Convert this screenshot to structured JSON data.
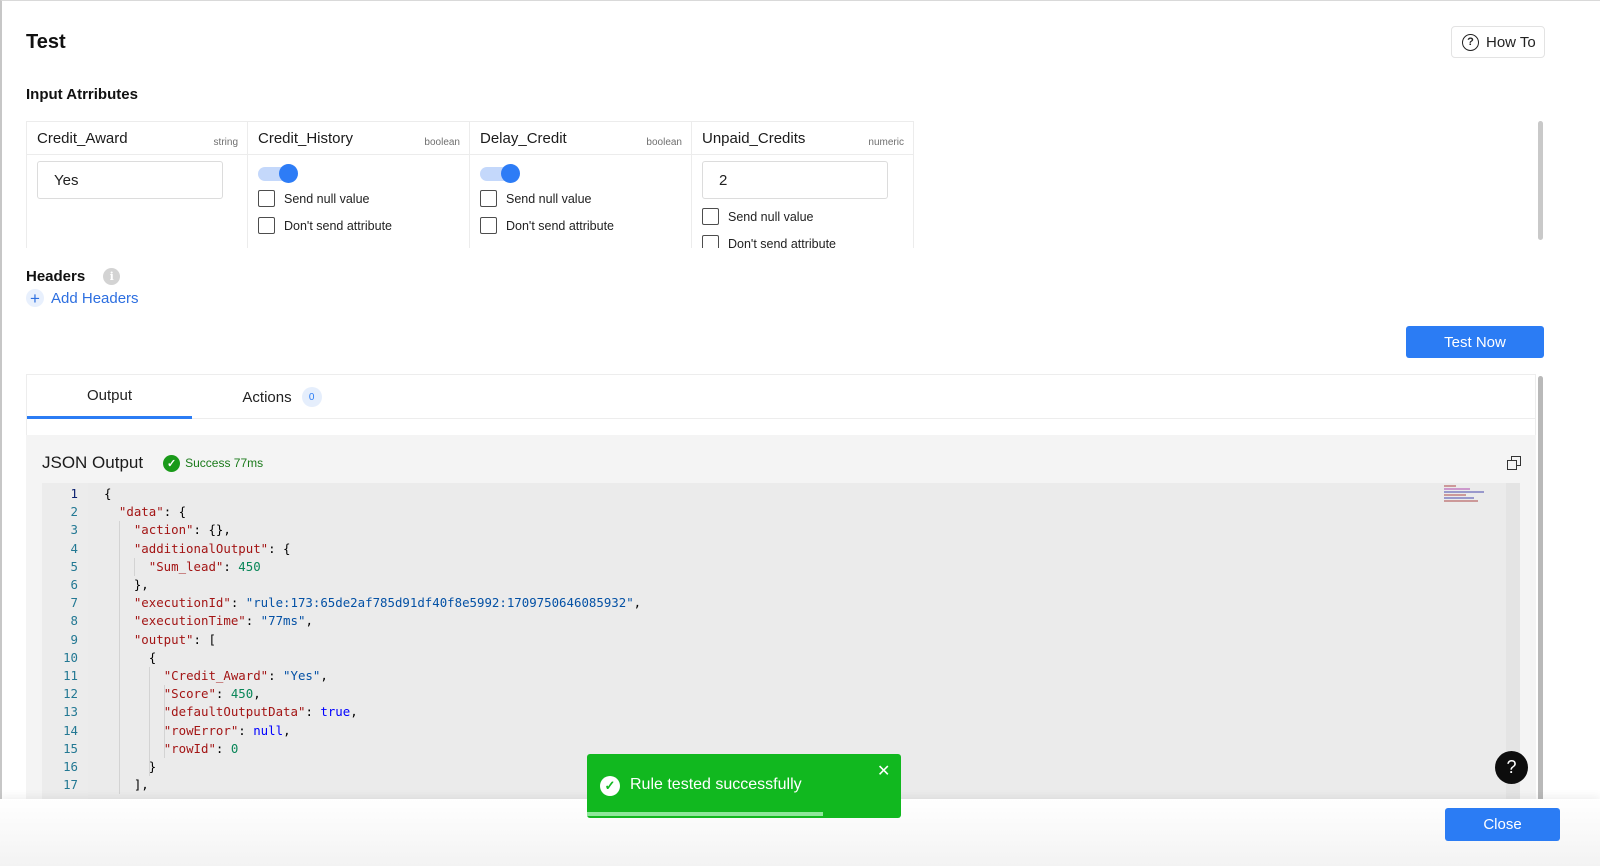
{
  "header": {
    "title": "Test",
    "howto_label": "How To"
  },
  "input_section": {
    "label": "Input Atrributes"
  },
  "attributes": [
    {
      "name": "Credit_Award",
      "type": "string",
      "value": "Yes"
    },
    {
      "name": "Credit_History",
      "type": "boolean",
      "toggle_on": true,
      "null_label": "Send null value",
      "dont_send_label": "Don't send attribute"
    },
    {
      "name": "Delay_Credit",
      "type": "boolean",
      "toggle_on": true,
      "null_label": "Send null value",
      "dont_send_label": "Don't send attribute"
    },
    {
      "name": "Unpaid_Credits",
      "type": "numeric",
      "value": "2",
      "null_label": "Send null value",
      "dont_send_label": "Don't send attribute"
    }
  ],
  "headers_section": {
    "label": "Headers",
    "add_label": "Add Headers"
  },
  "test_button": "Test Now",
  "tabs": {
    "output_label": "Output",
    "actions_label": "Actions",
    "actions_count": "0"
  },
  "json_output": {
    "title": "JSON Output",
    "status": "Success 77ms",
    "lines": [
      {
        "n": "1",
        "text": "{"
      },
      {
        "n": "2",
        "text": "  \"data\": {"
      },
      {
        "n": "3",
        "text": "    \"action\": {},"
      },
      {
        "n": "4",
        "text": "    \"additionalOutput\": {"
      },
      {
        "n": "5",
        "text": "      \"Sum_lead\": 450"
      },
      {
        "n": "6",
        "text": "    },"
      },
      {
        "n": "7",
        "text": "    \"executionId\": \"rule:173:65de2af785d91df40f8e5992:1709750646085932\","
      },
      {
        "n": "8",
        "text": "    \"executionTime\": \"77ms\","
      },
      {
        "n": "9",
        "text": "    \"output\": ["
      },
      {
        "n": "10",
        "text": "      {"
      },
      {
        "n": "11",
        "text": "        \"Credit_Award\": \"Yes\","
      },
      {
        "n": "12",
        "text": "        \"Score\": 450,"
      },
      {
        "n": "13",
        "text": "        \"defaultOutputData\": true,"
      },
      {
        "n": "14",
        "text": "        \"rowError\": null,"
      },
      {
        "n": "15",
        "text": "        \"rowId\": 0"
      },
      {
        "n": "16",
        "text": "      }"
      },
      {
        "n": "17",
        "text": "    ],"
      }
    ]
  },
  "toast": {
    "message": "Rule tested successfully",
    "close": "✕"
  },
  "help_label": "?",
  "close_button": "Close",
  "colors": {
    "accent": "#2b7cf4",
    "success": "#11b81f"
  }
}
